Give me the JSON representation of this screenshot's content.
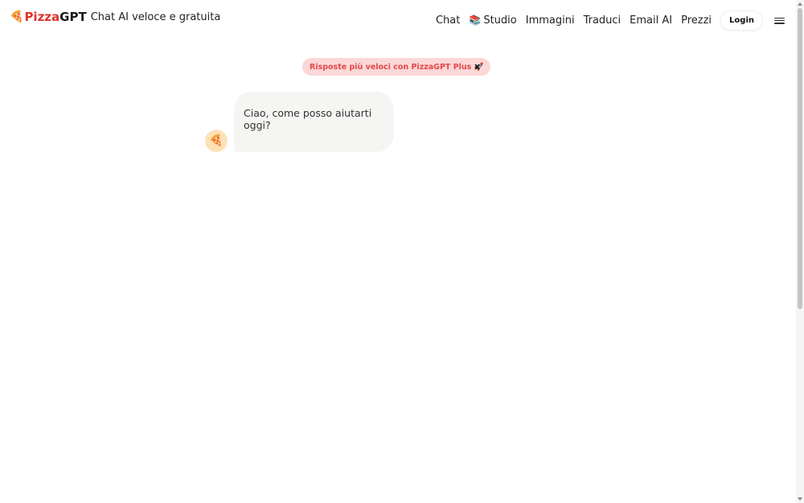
{
  "header": {
    "brand_icon": "🍕",
    "brand_pizza": "Pizza",
    "brand_gpt": "GPT",
    "tagline": "Chat AI veloce e gratuita",
    "nav": {
      "chat": "Chat",
      "studio_emoji": "📚",
      "studio": "Studio",
      "immagini": "Immagini",
      "traduci": "Traduci",
      "email_ai": "Email AI",
      "prezzi": "Prezzi"
    },
    "login_label": "Login"
  },
  "promo": {
    "text": "Risposte più veloci con PizzaGPT Plus 🚀",
    "close_label": "x"
  },
  "chat": {
    "avatar_icon": "🍕",
    "message": "Ciao, come posso aiutarti oggi?"
  },
  "colors": {
    "brand_red": "#e0322d",
    "promo_bg": "#fcd7d7",
    "promo_text": "#e04a4a",
    "bubble_bg": "#f5f5f3",
    "avatar_bg": "#fde1b8"
  },
  "icons": {
    "brand": "pizza-icon",
    "studio": "books-icon",
    "menu": "hamburger-menu-icon",
    "avatar": "pizza-avatar-icon"
  }
}
